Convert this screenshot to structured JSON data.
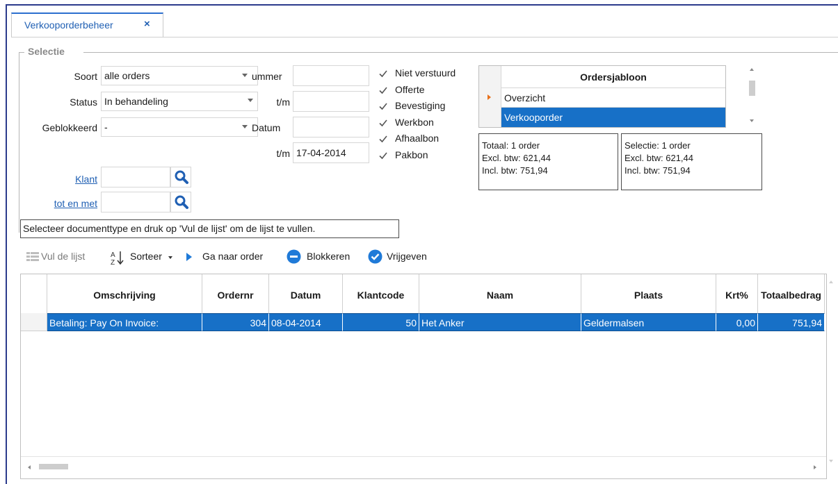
{
  "tab": {
    "label": "Verkooporderbeheer",
    "close": "×"
  },
  "group": {
    "title": "Selectie"
  },
  "filters": {
    "soort_label": "Soort",
    "soort_value": "alle orders",
    "status_label": "Status",
    "status_value": "In behandeling",
    "geblokkeerd_label": "Geblokkeerd",
    "geblokkeerd_value": "-",
    "nummer_label": "ummer",
    "tm1_label": "t/m",
    "nummer_from": "",
    "nummer_to": "",
    "datum_label": "Datum",
    "tm2_label": "t/m",
    "datum_from": "",
    "datum_to": "17-04-2014",
    "klant_label": "Klant",
    "totenmet_label": "tot en met",
    "klant_value": "",
    "totenmet_value": ""
  },
  "checkboxes": [
    {
      "label": "Niet verstuurd",
      "checked": true
    },
    {
      "label": "Offerte",
      "checked": true
    },
    {
      "label": "Bevestiging",
      "checked": true
    },
    {
      "label": "Werkbon",
      "checked": true
    },
    {
      "label": "Afhaalbon",
      "checked": true
    },
    {
      "label": "Pakbon",
      "checked": true
    }
  ],
  "ordersjabloon": {
    "header": "Ordersjabloon",
    "rows": [
      "Overzicht",
      "Verkooporder"
    ],
    "selected_row": "Verkooporder"
  },
  "totaal": {
    "line1": "Totaal: 1 order",
    "line2": "Excl. btw: 621,44",
    "line3": "Incl. btw: 751,94"
  },
  "selectie": {
    "line1": "Selectie: 1 order",
    "line2": "Excl. btw: 621,44",
    "line3": "Incl. btw: 751,94"
  },
  "hint": "Selecteer documenttype en druk op 'Vul de lijst' om de lijst te vullen.",
  "toolbar": {
    "vul": "Vul de lijst",
    "sorteer": "Sorteer",
    "ganaar": "Ga naar order",
    "blokkeren": "Blokkeren",
    "vrijgeven": "Vrijgeven"
  },
  "grid": {
    "headers": [
      "Omschrijving",
      "Ordernr",
      "Datum",
      "Klantcode",
      "Naam",
      "Plaats",
      "Krt%",
      "Totaalbedrag"
    ],
    "rows": [
      [
        "Betaling: Pay On Invoice:",
        "304",
        "08-04-2014",
        "50",
        "Het Anker",
        "Geldermalsen",
        "0,00",
        "751,94"
      ]
    ]
  },
  "colors": {
    "accent": "#1f5fb3",
    "selection": "#1770c7",
    "frame": "#2b3a8c"
  }
}
